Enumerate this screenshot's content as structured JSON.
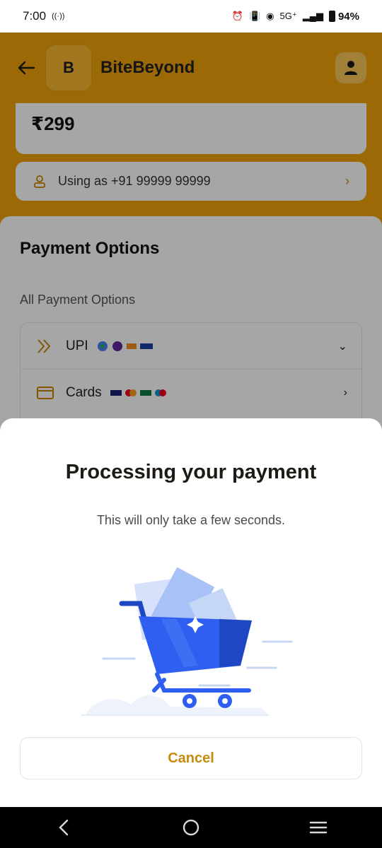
{
  "status_bar": {
    "time": "7:00",
    "network": "5G⁺",
    "battery": "94%"
  },
  "header": {
    "logo_letter": "B",
    "brand_name": "BiteBeyond"
  },
  "order": {
    "amount": "₹299",
    "user_label": "Using as +91 99999 99999"
  },
  "payment": {
    "title": "Payment Options",
    "subtitle": "All Payment Options",
    "options": [
      {
        "label": "UPI",
        "icon": "upi-icon",
        "expanded": true
      },
      {
        "label": "Cards",
        "icon": "card-icon",
        "expanded": false
      }
    ]
  },
  "modal": {
    "title": "Processing your payment",
    "subtitle": "This will only take a few seconds.",
    "cancel_label": "Cancel",
    "illustration": "shopping-cart-icon"
  },
  "colors": {
    "brand": "#f0a10b",
    "accent_text": "#c78b0b",
    "cart_blue": "#2f5ff0"
  }
}
